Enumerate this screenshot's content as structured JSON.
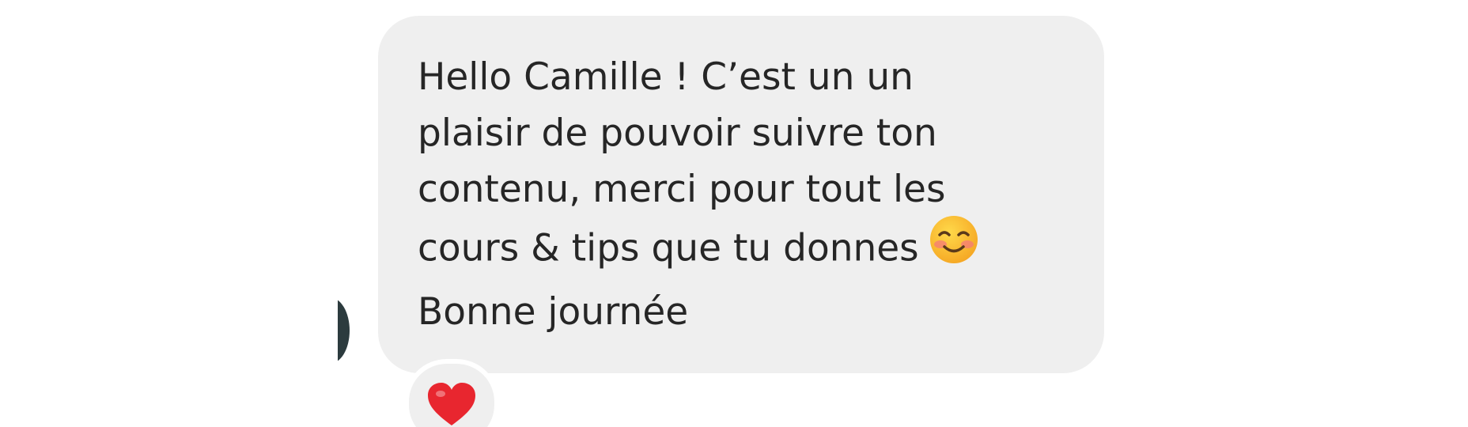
{
  "message": {
    "lines": [
      "Hello Camille ! C’est un un",
      "plaisir de pouvoir suivre ton",
      "contenu, merci pour tout les",
      "cours & tips que tu donnes",
      "Bonne journée"
    ],
    "inline_emoji": "smiling-face-with-blush-emoji",
    "bubble_color": "#efefef",
    "text_color": "#262626"
  },
  "reaction": {
    "emoji": "red-heart-emoji",
    "color": "#e8262f"
  },
  "avatar": {
    "color": "#2c3b3e"
  }
}
